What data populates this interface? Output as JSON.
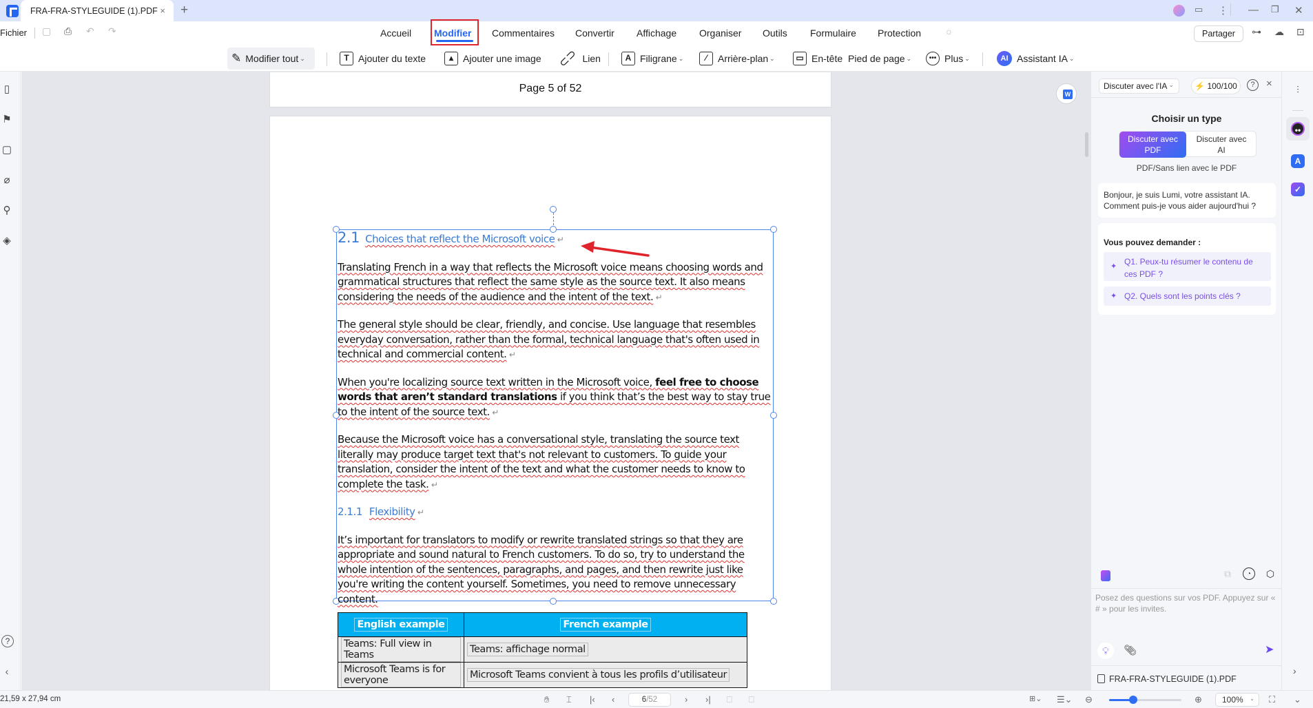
{
  "window": {
    "tab_title": "FRA-FRA-STYLEGUIDE (1).PDF",
    "new_tab": "+",
    "close_tab": "×",
    "controls": {
      "minimize": "—",
      "restore": "❐",
      "close": "✕"
    }
  },
  "menubar": {
    "file": "Fichier",
    "items": [
      {
        "label": "Accueil",
        "active": false
      },
      {
        "label": "Modifier",
        "active": true
      },
      {
        "label": "Commentaires",
        "active": false
      },
      {
        "label": "Convertir",
        "active": false
      },
      {
        "label": "Affichage",
        "active": false
      },
      {
        "label": "Organiser",
        "active": false
      },
      {
        "label": "Outils",
        "active": false
      },
      {
        "label": "Formulaire",
        "active": false
      },
      {
        "label": "Protection",
        "active": false
      }
    ],
    "share": "Partager"
  },
  "toolbar": {
    "edit_all": "Modifier tout",
    "add_text": "Ajouter du texte",
    "add_image": "Ajouter une image",
    "link": "Lien",
    "watermark": "Filigrane",
    "background": "Arrière-plan",
    "header": "En-tête",
    "footer": "Pied de page",
    "more": "Plus",
    "ai_assistant": "Assistant IA",
    "ai_badge": "AI"
  },
  "document": {
    "page_header": "Page 5 of 52",
    "heading_2_1": {
      "number": "2.1",
      "title": "Choices that reflect the Microsoft voice"
    },
    "paragraphs": [
      "Translating French in a way that reflects the Microsoft voice means choosing words and grammatical structures that reflect the same style as the source text. It also means considering the needs of the audience and the intent of the text.",
      "The general style should be clear, friendly, and concise. Use language that resembles everyday conversation, rather than the formal, technical language that's often used in technical and commercial content.",
      {
        "before": "When you're localizing source text written in the Microsoft voice, ",
        "bold": "feel free to choose words that aren’t standard translations",
        "after": " if you think that’s the best way to stay true to the intent of the source text."
      },
      "Because the Microsoft voice has a conversational style, translating the source text literally may produce target text that's not relevant to customers. To guide your translation, consider the intent of the text and what the customer needs to know to complete the task."
    ],
    "heading_2_1_1": {
      "number": "2.1.1",
      "title": "Flexibility"
    },
    "flex_paragraph": "It’s important for translators to modify or rewrite translated strings so that they are appropriate and sound natural to French customers. To do so, try to understand the whole intention of the sentences, paragraphs, and pages, and then rewrite just like you're writing the content yourself. Sometimes, you need to remove unnecessary content.",
    "table": {
      "headers": [
        "English example",
        "French example"
      ],
      "rows": [
        [
          "Teams: Full view in Teams",
          "Teams: affichage normal"
        ],
        [
          "Microsoft Teams is for everyone",
          "Microsoft Teams convient à tous les profils d’utilisateur"
        ]
      ]
    },
    "header_color": "#00b0f0",
    "selection_color": "#4f86e8",
    "annotation_arrow_color": "#e0242b"
  },
  "ai_panel": {
    "mode_select": "Discuter avec l'IA",
    "credits": "100/100",
    "help": "?",
    "close": "×",
    "choose_type_title": "Choisir un type",
    "type_options": [
      {
        "line1": "Discuter avec",
        "line2": "PDF",
        "selected": true
      },
      {
        "line1": "Discuter avec",
        "line2": "AI",
        "selected": false
      }
    ],
    "type_subtitle": "PDF/Sans lien avec le PDF",
    "greeting": "Bonjour, je suis Lumi, votre assistant IA. Comment puis-je vous aider aujourd'hui ?",
    "suggestions_title": "Vous pouvez demander :",
    "suggestions": [
      "Q1. Peux-tu résumer le contenu de ces PDF ?",
      "Q2. Quels sont les points clés ?"
    ],
    "input_placeholder": "Posez des questions sur vos PDF. Appuyez sur « # » pour les invites.",
    "attached_file": "FRA-FRA-STYLEGUIDE (1).PDF",
    "accent_color": "#7a4de8"
  },
  "statusbar": {
    "page_size": "21,59 x 27,94 cm",
    "current_page": "6",
    "total_pages": "/52",
    "zoom_level": "100%",
    "zoom_slider_fraction": 0.33
  }
}
